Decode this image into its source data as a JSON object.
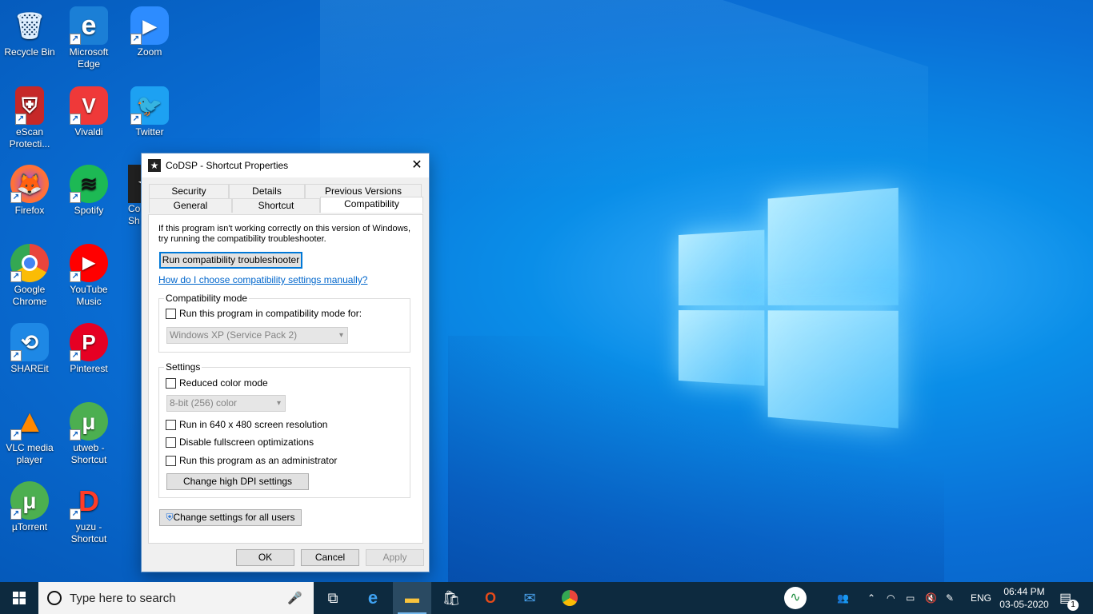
{
  "desktop": {
    "icons": [
      {
        "label": "Recycle Bin",
        "color": "#cfe8ff",
        "glyph": "🗑"
      },
      {
        "label": "Microsoft Edge",
        "color": "#1b7fd6",
        "glyph": "e"
      },
      {
        "label": "Zoom",
        "color": "#2d8cff",
        "glyph": "▶"
      },
      {
        "label": "eScan Protecti...",
        "color": "#c62828",
        "glyph": "⛨"
      },
      {
        "label": "Vivaldi",
        "color": "#ef3939",
        "glyph": "V"
      },
      {
        "label": "Twitter",
        "color": "#1da1f2",
        "glyph": "🐦"
      },
      {
        "label": "Firefox",
        "color": "#ff7139",
        "glyph": "🦊"
      },
      {
        "label": "Spotify",
        "color": "#1db954",
        "glyph": "≋"
      },
      {
        "label": "Co Sh",
        "color": "#222222",
        "glyph": "★"
      },
      {
        "label": "Google Chrome",
        "color": "#e8453c",
        "glyph": "◉"
      },
      {
        "label": "YouTube Music",
        "color": "#ff0000",
        "glyph": "▶"
      },
      {
        "label": "SHAREit",
        "color": "#1e88e5",
        "glyph": "⟲"
      },
      {
        "label": "Pinterest",
        "color": "#e60023",
        "glyph": "P"
      },
      {
        "label": "VLC media player",
        "color": "#ff8800",
        "glyph": "▲"
      },
      {
        "label": "utweb - Shortcut",
        "color": "#4caf50",
        "glyph": "μ"
      },
      {
        "label": "µTorrent",
        "color": "#4caf50",
        "glyph": "μ"
      },
      {
        "label": "yuzu - Shortcut",
        "color": "#ffffff",
        "glyph": "D"
      }
    ]
  },
  "dialog": {
    "title": "CoDSP - Shortcut Properties",
    "close": "✕",
    "tabs": {
      "security": "Security",
      "details": "Details",
      "previous_versions": "Previous Versions",
      "general": "General",
      "shortcut": "Shortcut",
      "compatibility": "Compatibility"
    },
    "intro_line1": "If this program isn't working correctly on this version of Windows,",
    "intro_line2": "try running the compatibility troubleshooter.",
    "troubleshooter_button": "Run compatibility troubleshooter",
    "manual_link": "How do I choose compatibility settings manually?",
    "compat_mode": {
      "legend": "Compatibility mode",
      "checkbox_label": "Run this program in compatibility mode for:",
      "checked": false,
      "os_value": "Windows XP (Service Pack 2)"
    },
    "settings": {
      "legend": "Settings",
      "reduced_color": "Reduced color mode",
      "color_value": "8-bit (256) color",
      "resolution": "Run in 640 x 480 screen resolution",
      "fullscreen": "Disable fullscreen optimizations",
      "admin": "Run this program as an administrator",
      "dpi_button": "Change high DPI settings"
    },
    "all_users_button": "Change settings for all users",
    "ok": "OK",
    "cancel": "Cancel",
    "apply": "Apply"
  },
  "taskbar": {
    "search_placeholder": "Type here to search",
    "language": "ENG",
    "time": "06:44 PM",
    "date": "03-05-2020",
    "notification_count": "1"
  }
}
